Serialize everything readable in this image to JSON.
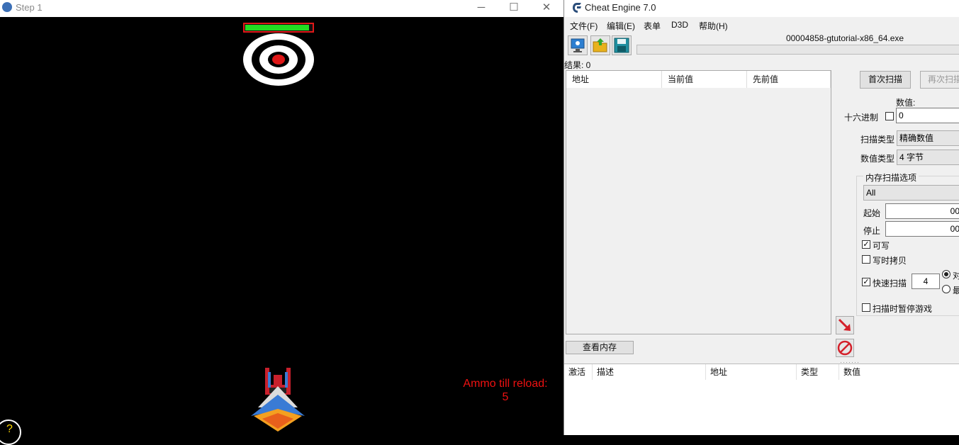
{
  "game_window": {
    "title": "Step 1",
    "controls": {
      "minimize": "─",
      "maximize": "☐",
      "close": "✕"
    },
    "health_fraction": 0.96,
    "ammo_label": "Ammo till reload:",
    "ammo_value": "5",
    "help_glyph": "?",
    "colors": {
      "health_fill": "#22dd22",
      "health_border": "#e01818",
      "ammo_text": "#ee1111"
    }
  },
  "cheat_engine": {
    "title": "Cheat Engine 7.0",
    "menu": [
      "文件(F)",
      "编辑(E)",
      "表单",
      "D3D",
      "帮助(H)"
    ],
    "toolbar_icons": [
      "process-select-icon",
      "open-folder-icon",
      "save-icon"
    ],
    "process_name": "00004858-gtutorial-x86_64.exe",
    "results_label": "结果: 0",
    "results_columns": [
      "地址",
      "当前值",
      "先前值"
    ],
    "view_memory_button": "查看内存",
    "first_scan_button": "首次扫描",
    "next_scan_button": "再次扫描",
    "value_label": "数值:",
    "hex_label": "十六进制",
    "value_input": "0",
    "scan_type_label": "扫描类型",
    "scan_type_value": "精确数值",
    "value_type_label": "数值类型",
    "value_type_value": "4 字节",
    "memory_options_label": "内存扫描选项",
    "memory_region_value": "All",
    "start_label": "起始",
    "start_value": "00",
    "stop_label": "停止",
    "stop_value": "00",
    "writable_label": "可写",
    "writable_checked": true,
    "copy_on_write_label": "写时拷贝",
    "copy_on_write_checked": false,
    "fast_scan_label": "快速扫描",
    "fast_scan_checked": true,
    "fast_scan_value": "4",
    "align_radio_label": "对",
    "last_digits_radio_label": "最",
    "pause_game_label": "扫描时暂停游戏",
    "pause_game_checked": false,
    "address_list_columns": [
      "激活",
      "描述",
      "地址",
      "类型",
      "数值"
    ]
  }
}
